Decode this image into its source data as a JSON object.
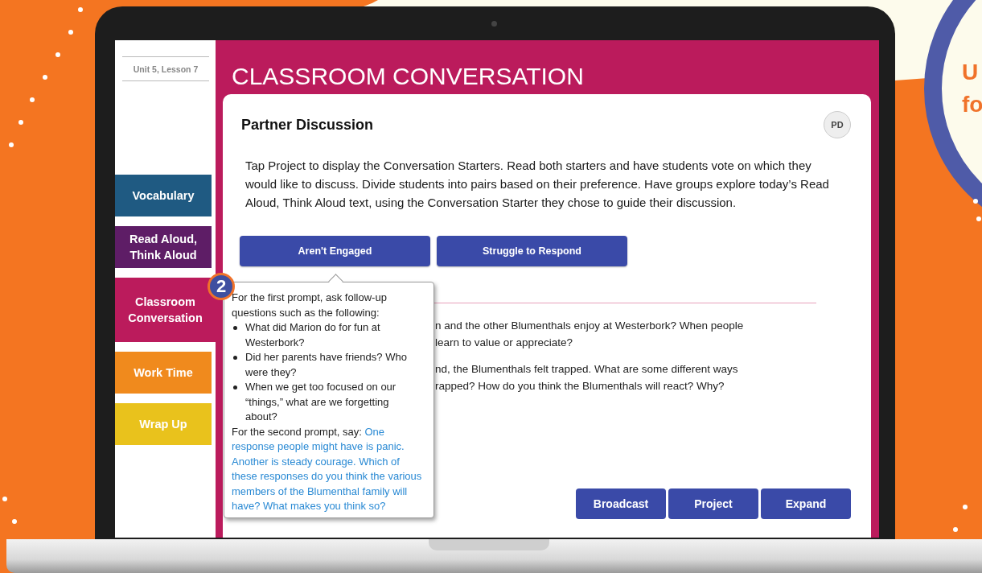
{
  "background": {
    "callout_lines": [
      "U",
      "fo"
    ]
  },
  "sidebar": {
    "lesson": "Unit 5, Lesson 7",
    "items": [
      {
        "label": "Vocabulary",
        "color": "#1f5a82",
        "selected": false
      },
      {
        "label": "Read Aloud, Think Aloud",
        "color": "#5e1d66",
        "selected": false
      },
      {
        "label": "Classroom Conversation",
        "color": "#bb1b5c",
        "selected": true
      },
      {
        "label": "Work Time",
        "color": "#f08a1d",
        "selected": false
      },
      {
        "label": "Wrap Up",
        "color": "#e9c21c",
        "selected": false
      }
    ]
  },
  "header": {
    "title": "CLASSROOM CONVERSATION"
  },
  "card": {
    "heading": "Partner Discussion",
    "badge": "PD",
    "instructions": "Tap Project to display the Conversation Starters. Read both starters and have students vote on which they would like to discuss. Divide students into pairs based on their preference. Have groups explore today’s Read Aloud, Think Aloud text, using the Conversation Starter they chose to guide their discussion.",
    "support_buttons": [
      "Aren't Engaged",
      "Struggle to Respond"
    ],
    "popup": {
      "step": "2",
      "intro": "For the first prompt, ask follow-up questions such as the following:",
      "bullets": [
        "What did Marion do for fun at Westerbork?",
        "Did her parents have friends? Who were they?",
        "When we get too focused on our “things,” what are we forgetting about?"
      ],
      "lead": "For the second prompt, say:",
      "quote": "One response people might have is panic. Another is steady courage. Which of these responses do you think the various members of the Blumenthal family will have? What makes you think so?"
    },
    "prompts": [
      {
        "lines": [
          "n and the other Blumenthals enjoy at Westerbork? When people",
          "learn to value or appreciate?"
        ]
      },
      {
        "lines": [
          "nd, the Blumenthals felt trapped. What are some different ways",
          "rapped? How do you think the Blumenthals will react? Why?"
        ]
      }
    ],
    "actions": [
      "Broadcast",
      "Project",
      "Expand"
    ]
  }
}
